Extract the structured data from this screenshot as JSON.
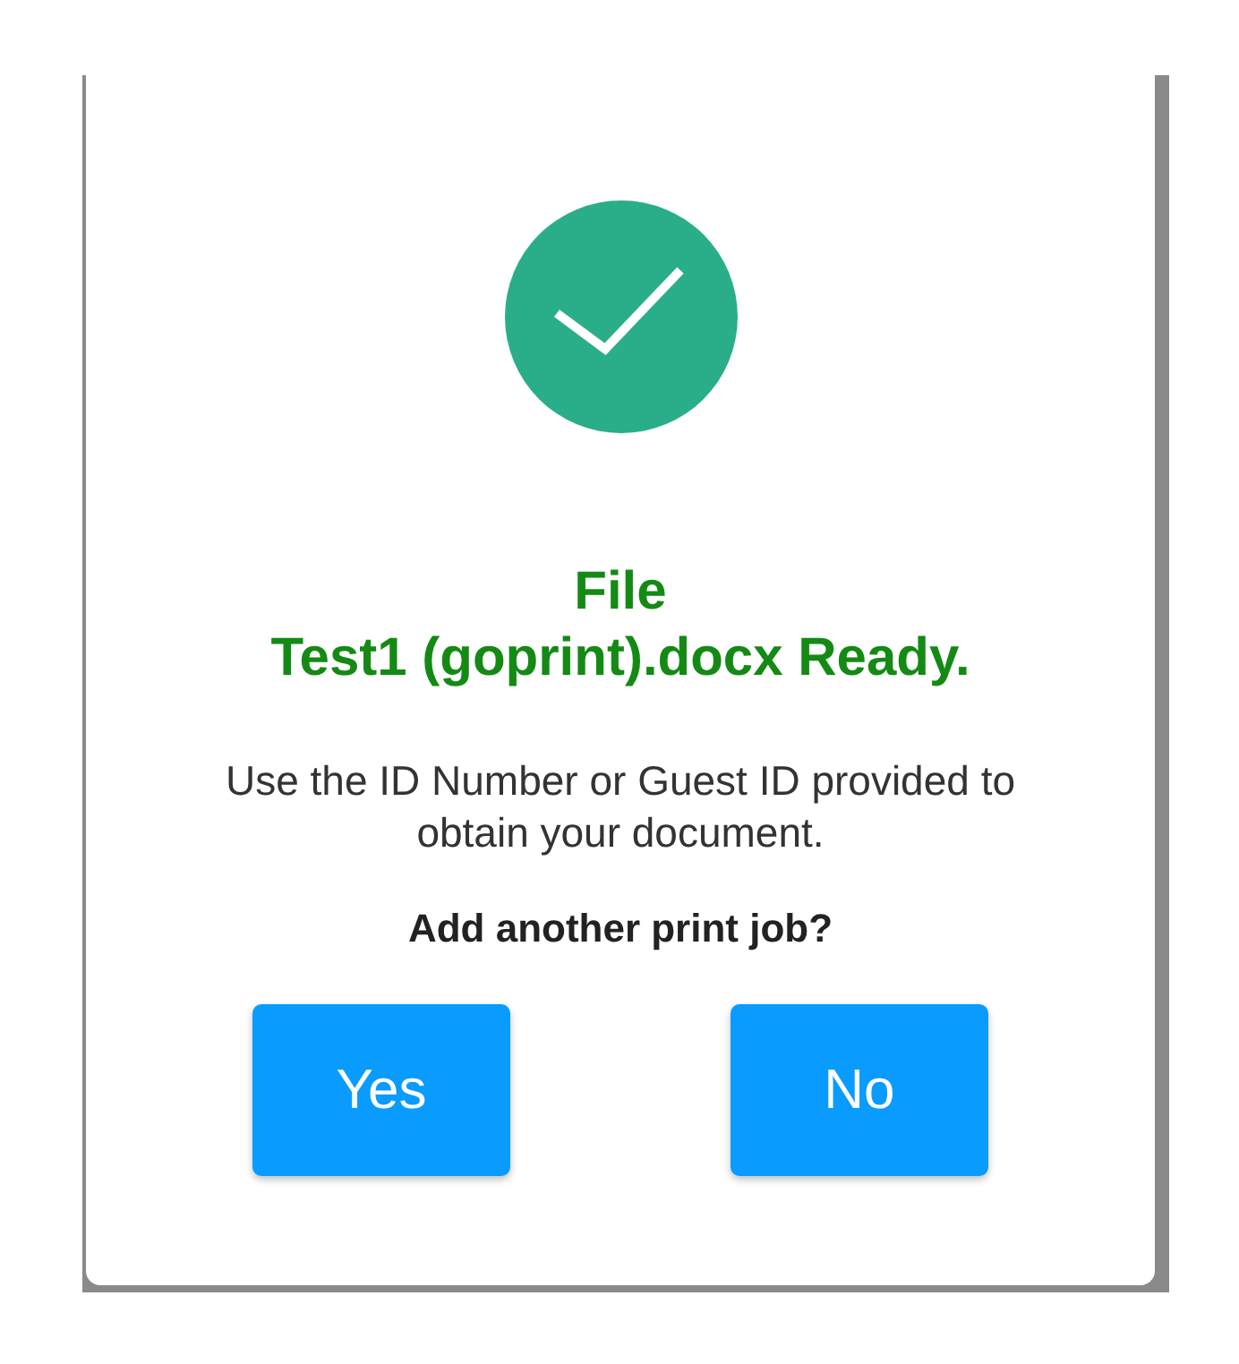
{
  "dialog": {
    "title_lines": [
      "File",
      "Test1 (goprint).docx Ready."
    ],
    "message": "Use the ID Number or Guest ID provided to obtain your document.",
    "question": "Add another print job?",
    "buttons": [
      "Yes",
      "No"
    ]
  }
}
